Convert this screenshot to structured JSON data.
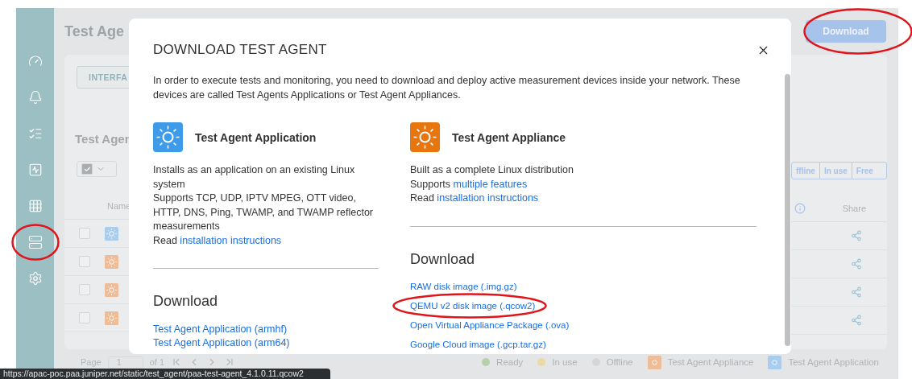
{
  "sidebar": {
    "items": [
      {
        "kind": "gauge",
        "circled": false
      },
      {
        "kind": "bell",
        "circled": false
      },
      {
        "kind": "checklist",
        "circled": false
      },
      {
        "kind": "pulse",
        "circled": false
      },
      {
        "kind": "grid",
        "circled": false
      },
      {
        "kind": "server",
        "circled": true
      },
      {
        "kind": "settings",
        "circled": false
      }
    ]
  },
  "page": {
    "title": "Test Age",
    "download_button": {
      "label": "Download",
      "circled": true
    },
    "tab": "INTERFA",
    "section_title": "Test Agen",
    "filters": [
      "ffline",
      "In use",
      "Free"
    ],
    "table": {
      "columns": [
        "Name",
        "Share"
      ],
      "rows": [
        {
          "kind": "application",
          "checked": false
        },
        {
          "kind": "appliance",
          "checked": false
        },
        {
          "kind": "appliance",
          "checked": false
        },
        {
          "kind": "appliance",
          "checked": false
        }
      ]
    }
  },
  "pagination": {
    "label": "Page",
    "value": "1",
    "total": "of 1"
  },
  "legend": [
    {
      "kind": "status",
      "label": "Ready",
      "color": "#b5d3ab"
    },
    {
      "kind": "status",
      "label": "In use",
      "color": "#ecd9a4"
    },
    {
      "kind": "status",
      "label": "Offline",
      "color": "#d6d6d6"
    },
    {
      "kind": "agent",
      "label": "Test Agent Appliance",
      "color": "#eebc96"
    },
    {
      "kind": "agent",
      "label": "Test Agent Application",
      "color": "#a8cdef"
    }
  ],
  "modal": {
    "title": "DOWNLOAD TEST AGENT",
    "intro": "In order to execute tests and monitoring, you need to download and deploy active measurement devices inside your network. These devices are called Test Agents Applications or Test Agent Appliances.",
    "columns": [
      {
        "title": "Test Agent Application",
        "color": "#3d9be9",
        "description": [
          {
            "text": "Installs as an application on an existing Linux system"
          },
          {
            "text": "Supports TCP, UDP, IPTV MPEG, OTT video, HTTP, DNS, Ping, TWAMP, and TWAMP reflector measurements"
          },
          {
            "text": "Read ",
            "link": "installation instructions"
          }
        ],
        "download_heading": "Download",
        "links": [
          {
            "label": "Test Agent Application (armhf)",
            "circled": false
          },
          {
            "label": "Test Agent Application (arm64)",
            "circled": false
          }
        ]
      },
      {
        "title": "Test Agent Appliance",
        "color": "#e8760f",
        "description": [
          {
            "text": "Built as a complete Linux distribution"
          },
          {
            "text": "Supports ",
            "link": "multiple features"
          },
          {
            "text": "Read ",
            "link": "installation instructions"
          }
        ],
        "download_heading": "Download",
        "links": [
          {
            "label": "RAW disk image (.img.gz)",
            "circled": false
          },
          {
            "label": "QEMU v2 disk image (.qcow2)",
            "circled": true
          },
          {
            "label": "Open Virtual Appliance Package (.ova)",
            "circled": false
          },
          {
            "label": "Google Cloud image (.gcp.tar.gz)",
            "circled": false
          }
        ]
      }
    ]
  },
  "status_url": "https://apac-poc.paa.juniper.net/static/test_agent/paa-test-agent_4.1.0.11.qcow2"
}
